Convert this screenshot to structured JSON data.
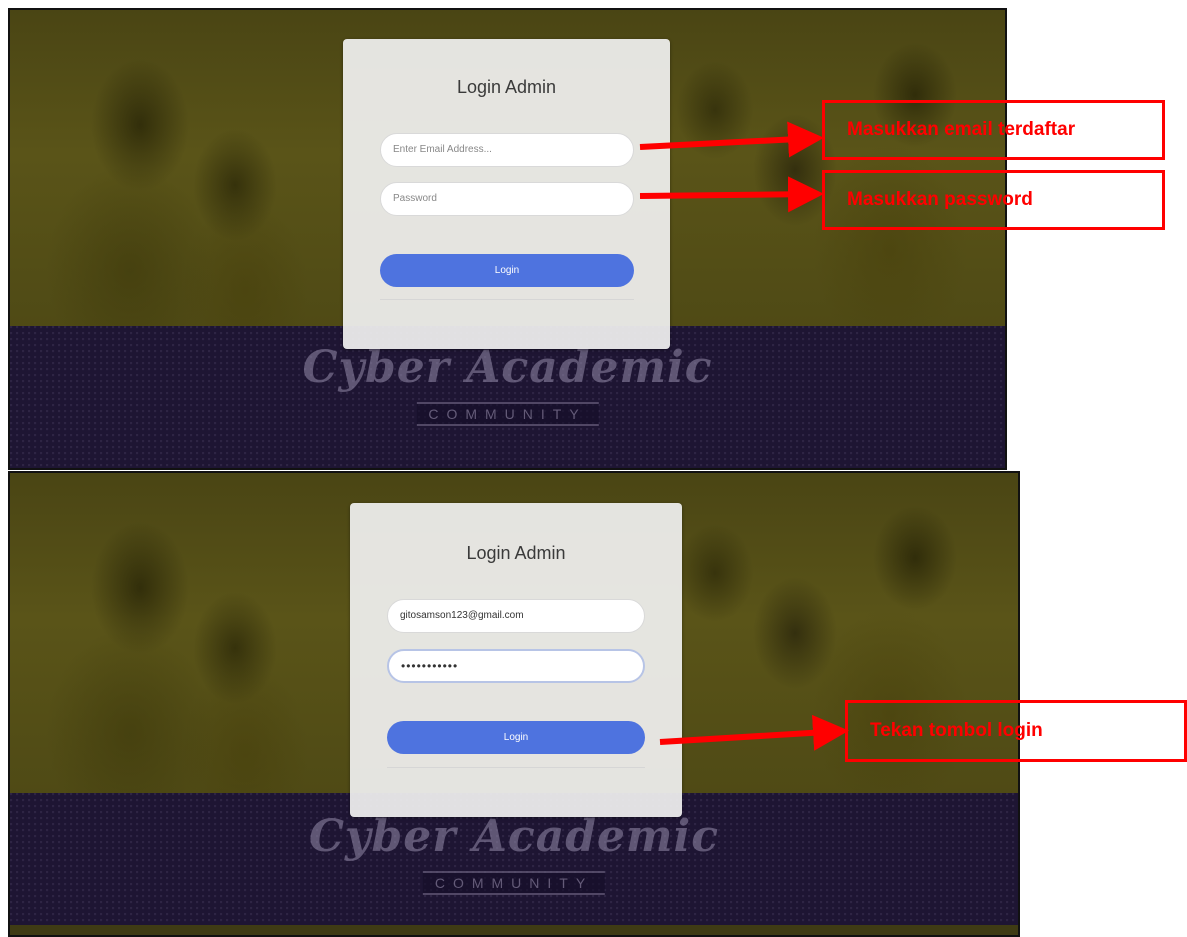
{
  "panels": [
    {
      "title": "Login Admin",
      "email_placeholder": "Enter Email Address...",
      "password_placeholder": "Password",
      "login_label": "Login",
      "brand_main": "Cyber Academic",
      "brand_sub": "COMMUNITY"
    },
    {
      "title": "Login Admin",
      "email_value": "gitosamson123@gmail.com",
      "password_value": "•••••••••••",
      "login_label": "Login",
      "brand_main": "Cyber Academic",
      "brand_sub": "COMMUNITY"
    }
  ],
  "annotations": {
    "email": "Masukkan email terdaftar",
    "password": "Masukkan password",
    "login": "Tekan tombol login"
  },
  "colors": {
    "annotation_red": "#ff0000",
    "login_button": "#4e73df",
    "band_dark": "#1e1533",
    "photo_tint": "#5a5418"
  }
}
